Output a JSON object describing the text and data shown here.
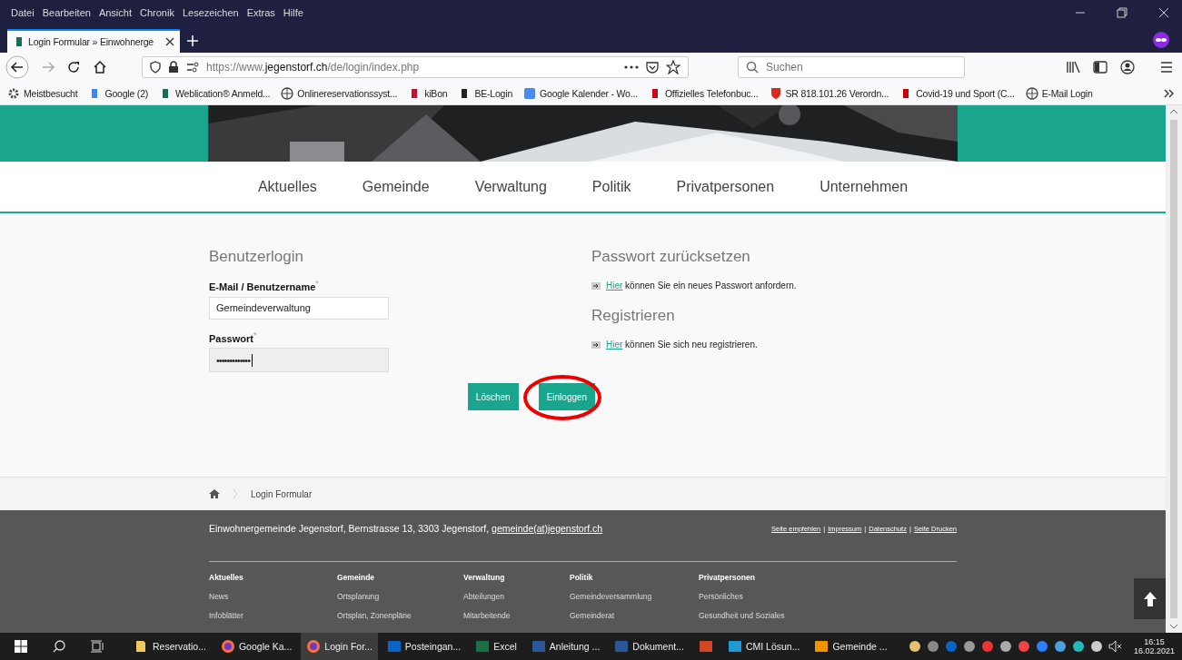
{
  "menu_bar": [
    "Datei",
    "Bearbeiten",
    "Ansicht",
    "Chronik",
    "Lesezeichen",
    "Extras",
    "Hilfe"
  ],
  "tabs": [
    {
      "label": "Login Formular » Einwohnerge",
      "selected": true
    }
  ],
  "address_bar": {
    "url_start": "https://www.",
    "url_domain": "jegenstorf.ch",
    "url_path": "/de/login/index.php"
  },
  "search": {
    "placeholder": "Suchen"
  },
  "bookmarks": [
    {
      "label": "Meistbesucht"
    },
    {
      "label": "Google (2)"
    },
    {
      "label": "Weblication® Anmeld..."
    },
    {
      "label": "Onlinereservationssyst..."
    },
    {
      "label": "kiBon"
    },
    {
      "label": "BE-Login"
    },
    {
      "label": "Google Kalender - Wo..."
    },
    {
      "label": "Offizielles Telefonbuc..."
    },
    {
      "label": "SR 818.101.26 Verordn..."
    },
    {
      "label": "Covid-19 und Sport (C..."
    },
    {
      "label": "E-Mail Login"
    }
  ],
  "nav": [
    "Aktuelles",
    "Gemeinde",
    "Verwaltung",
    "Politik",
    "Privatpersonen",
    "Unternehmen"
  ],
  "login": {
    "title": "Benutzerlogin",
    "username_label": "E-Mail / Benutzername",
    "username_value": "Gemeindeverwaltung",
    "password_label": "Passwort",
    "password_value": "•••••••••••••",
    "required_mark": "*",
    "buttons": [
      "Löschen",
      "Einloggen"
    ]
  },
  "side": [
    {
      "title": "Passwort zurücksetzen",
      "link": "Hier",
      "text": " können Sie ein neues Passwort anfordern."
    },
    {
      "title": "Registrieren",
      "link": "Hier",
      "text": " können Sie sich neu registrieren."
    }
  ],
  "breadcrumb": [
    "Login Formular"
  ],
  "footer": {
    "address": "Einwohnergemeinde Jegenstorf, Bernstrasse 13, 3303 Jegenstorf,",
    "email": "gemeinde(at)jegenstorf.ch",
    "links": [
      "Seite empfehlen",
      "Impressum",
      "Datenschutz",
      "Seite Drucken"
    ],
    "separator": "|",
    "columns": [
      {
        "title": "Aktuelles",
        "items": [
          "News",
          "Infoblätter"
        ]
      },
      {
        "title": "Gemeinde",
        "items": [
          "Ortsplanung",
          "Ortsplan, Zonenpläne"
        ]
      },
      {
        "title": "Verwaltung",
        "items": [
          "Abteilungen",
          "Mitarbeitende"
        ]
      },
      {
        "title": "Politik",
        "items": [
          "Gemeindeversammlung",
          "Gemeinderat"
        ]
      },
      {
        "title": "Privatpersonen",
        "items": [
          "Persönliches",
          "Gesundheit und Soziales"
        ]
      }
    ]
  },
  "taskbar": {
    "apps": [
      {
        "label": "Reservatio...",
        "selected": false
      },
      {
        "label": "Google Ka...",
        "selected": false
      },
      {
        "label": "Login For...",
        "selected": true
      },
      {
        "label": "Posteingan...",
        "selected": false
      },
      {
        "label": "Excel",
        "selected": false
      },
      {
        "label": "Anleitung ...",
        "selected": false
      },
      {
        "label": "Dokument...",
        "selected": false
      },
      {
        "selected": false
      },
      {
        "label": "CMI Lösun...",
        "selected": false
      },
      {
        "label": "Gemeinde ...",
        "selected": false
      }
    ],
    "time": "16:15",
    "date": "16.02.2021"
  }
}
